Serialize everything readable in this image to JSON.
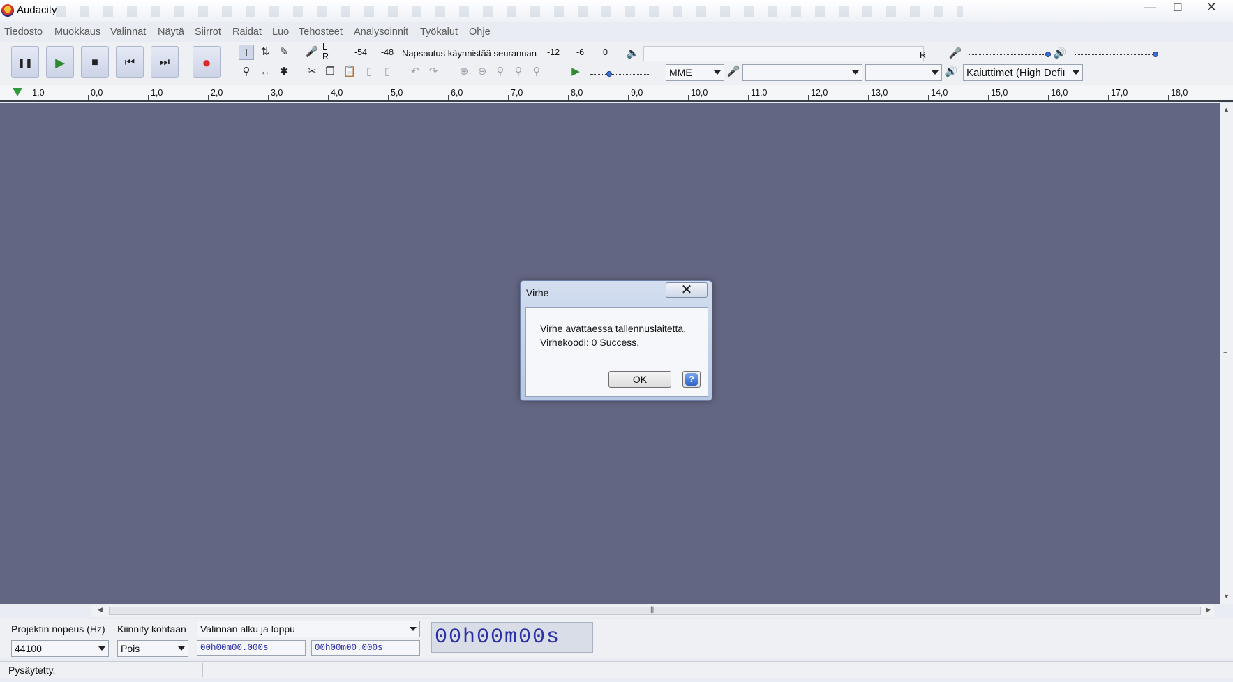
{
  "window": {
    "title": "Audacity",
    "controls": {
      "minimize": "—",
      "maximize": "□",
      "close": "✕"
    }
  },
  "menu": [
    "Tiedosto",
    "Muokkaus",
    "Valinnat",
    "Näytä",
    "Siirrot",
    "Raidat",
    "Luo",
    "Tehosteet",
    "Analysoinnit",
    "Työkalut",
    "Ohje"
  ],
  "transport": {
    "pause": "❚❚",
    "play": "▶",
    "stop": "■",
    "skip_start": "⏮",
    "skip_end": "⏭",
    "record": "●"
  },
  "meter": {
    "lr_top": "L",
    "lr_bottom": "R",
    "scale": [
      "-54",
      "-48"
    ],
    "hint": "Napsautus käynnistää seurannan",
    "scale_right": [
      "-12",
      "-6",
      "0"
    ],
    "play_r": "R"
  },
  "device": {
    "host": "MME",
    "recording": "",
    "channels": "",
    "playback": "Kaiuttimet (High Defiı"
  },
  "ruler": [
    "-1,0",
    "0,0",
    "1,0",
    "2,0",
    "3,0",
    "4,0",
    "5,0",
    "6,0",
    "7,0",
    "8,0",
    "9,0",
    "10,0",
    "11,0",
    "12,0",
    "13,0",
    "14,0",
    "15,0",
    "16,0",
    "17,0",
    "18,0"
  ],
  "selection_toolbar": {
    "rate_label": "Projektin nopeus (Hz)",
    "rate_value": "44100",
    "snap_label": "Kiinnity kohtaan",
    "snap_value": "Pois",
    "sel_mode": "Valinnan alku ja loppu",
    "start_time": "00h00m00.000s",
    "end_time": "00h00m00.000s",
    "audio_position": "00h00m00s"
  },
  "status": "Pysäytetty.",
  "dialog": {
    "title": "Virhe",
    "line1": "Virhe avattaessa tallennuslaitetta.",
    "line2": "Virhekoodi: 0 Success.",
    "ok": "OK",
    "help": "?"
  }
}
